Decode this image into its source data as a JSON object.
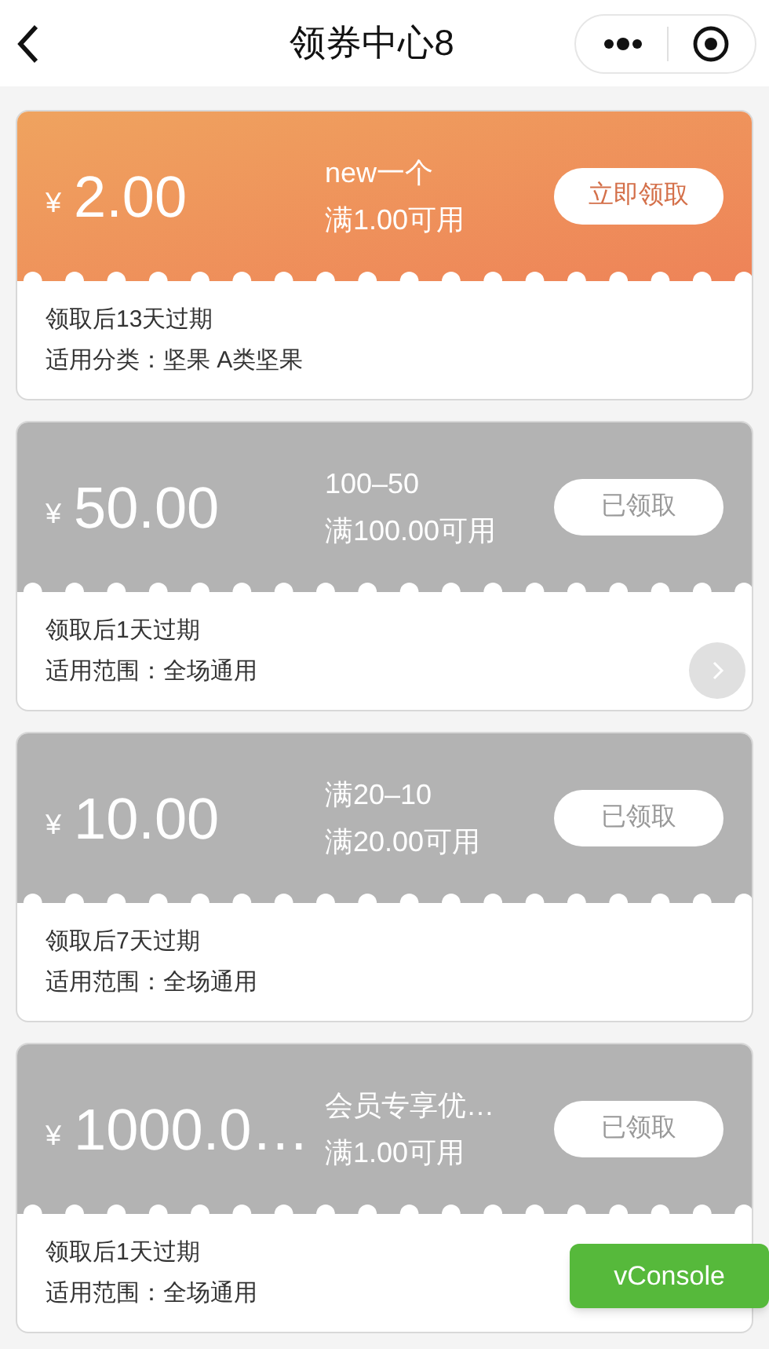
{
  "header": {
    "title": "领券中心8"
  },
  "coupons": [
    {
      "currency": "¥",
      "amount": "2.00",
      "name": "new一个",
      "condition": "满1.00可用",
      "button": "立即领取",
      "claimed": false,
      "expiry": "领取后13天过期",
      "scope": "适用分类：坚果 A类坚果",
      "more": false
    },
    {
      "currency": "¥",
      "amount": "50.00",
      "name": "100–50",
      "condition": "满100.00可用",
      "button": "已领取",
      "claimed": true,
      "expiry": "领取后1天过期",
      "scope": "适用范围：全场通用",
      "more": true
    },
    {
      "currency": "¥",
      "amount": "10.00",
      "name": "满20–10",
      "condition": "满20.00可用",
      "button": "已领取",
      "claimed": true,
      "expiry": "领取后7天过期",
      "scope": "适用范围：全场通用",
      "more": false
    },
    {
      "currency": "¥",
      "amount": "1000.0…",
      "name": "会员专享优…",
      "condition": "满1.00可用",
      "button": "已领取",
      "claimed": true,
      "expiry": "领取后1天过期",
      "scope": "适用范围：全场通用",
      "more": false
    }
  ],
  "console_button": "vConsole"
}
